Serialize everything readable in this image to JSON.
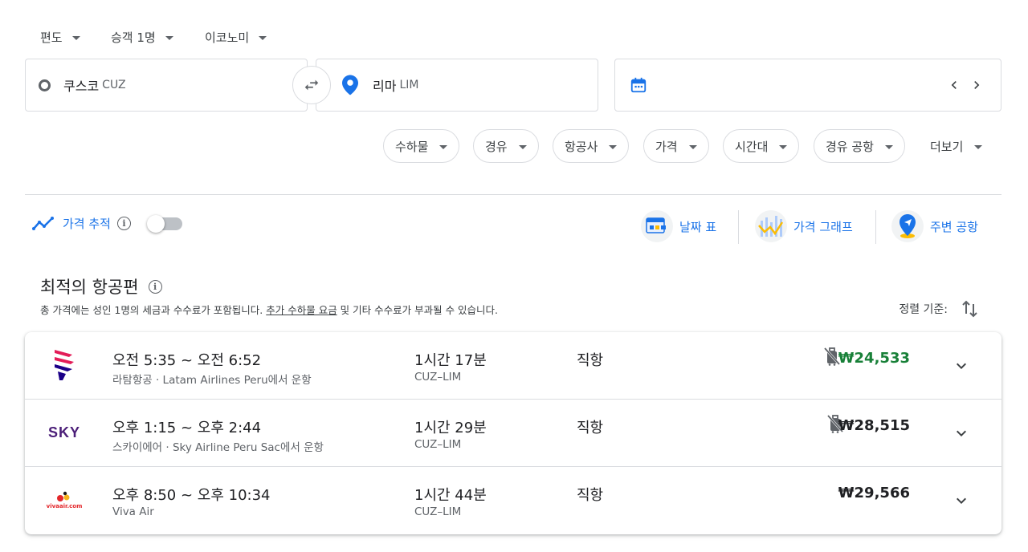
{
  "top": {
    "trip_type": "편도",
    "passengers": "승객 1명",
    "cabin": "이코노미"
  },
  "search": {
    "origin_city": "쿠스코",
    "origin_code": "CUZ",
    "destination_city": "리마",
    "destination_code": "LIM",
    "date": ""
  },
  "filters": [
    "수하물",
    "경유",
    "항공사",
    "가격",
    "시간대",
    "경유 공항"
  ],
  "more_label": "더보기",
  "tools": {
    "track_label": "가격 추적",
    "date_grid": "날짜 표",
    "price_graph": "가격 그래프",
    "nearby": "주변 공항"
  },
  "results": {
    "title": "최적의 항공편",
    "subtitle_pre": "총 가격에는 성인 1명의 세금과 수수료가 포함됩니다. ",
    "subtitle_link": "추가 수하물 요금",
    "subtitle_post": " 및 기타 수수료가 부과될 수 있습니다.",
    "sort_label": "정렬 기준:"
  },
  "flights": [
    {
      "times": "오전 5:35 ~ 오전 6:52",
      "carrier": "라탐항공 · Latam Airlines Peru에서 운항",
      "duration": "1시간 17분",
      "route": "CUZ–LIM",
      "stops": "직항",
      "price": "₩24,533",
      "no_carry_on": true,
      "logo_text": ""
    },
    {
      "times": "오후 1:15 ~ 오후 2:44",
      "carrier": "스카이에어 · Sky Airline Peru Sac에서 운항",
      "duration": "1시간 29분",
      "route": "CUZ–LIM",
      "stops": "직항",
      "price": "₩28,515",
      "no_carry_on": true,
      "logo_text": "SKY"
    },
    {
      "times": "오후 8:50 ~ 오후 10:34",
      "carrier": "Viva Air",
      "duration": "1시간 44분",
      "route": "CUZ–LIM",
      "stops": "직항",
      "price": "₩29,566",
      "no_carry_on": false,
      "logo_text": "vivaair.com"
    }
  ],
  "colors": {
    "accent": "#1a73e8",
    "good_price": "#188038",
    "border": "#dadce0"
  }
}
